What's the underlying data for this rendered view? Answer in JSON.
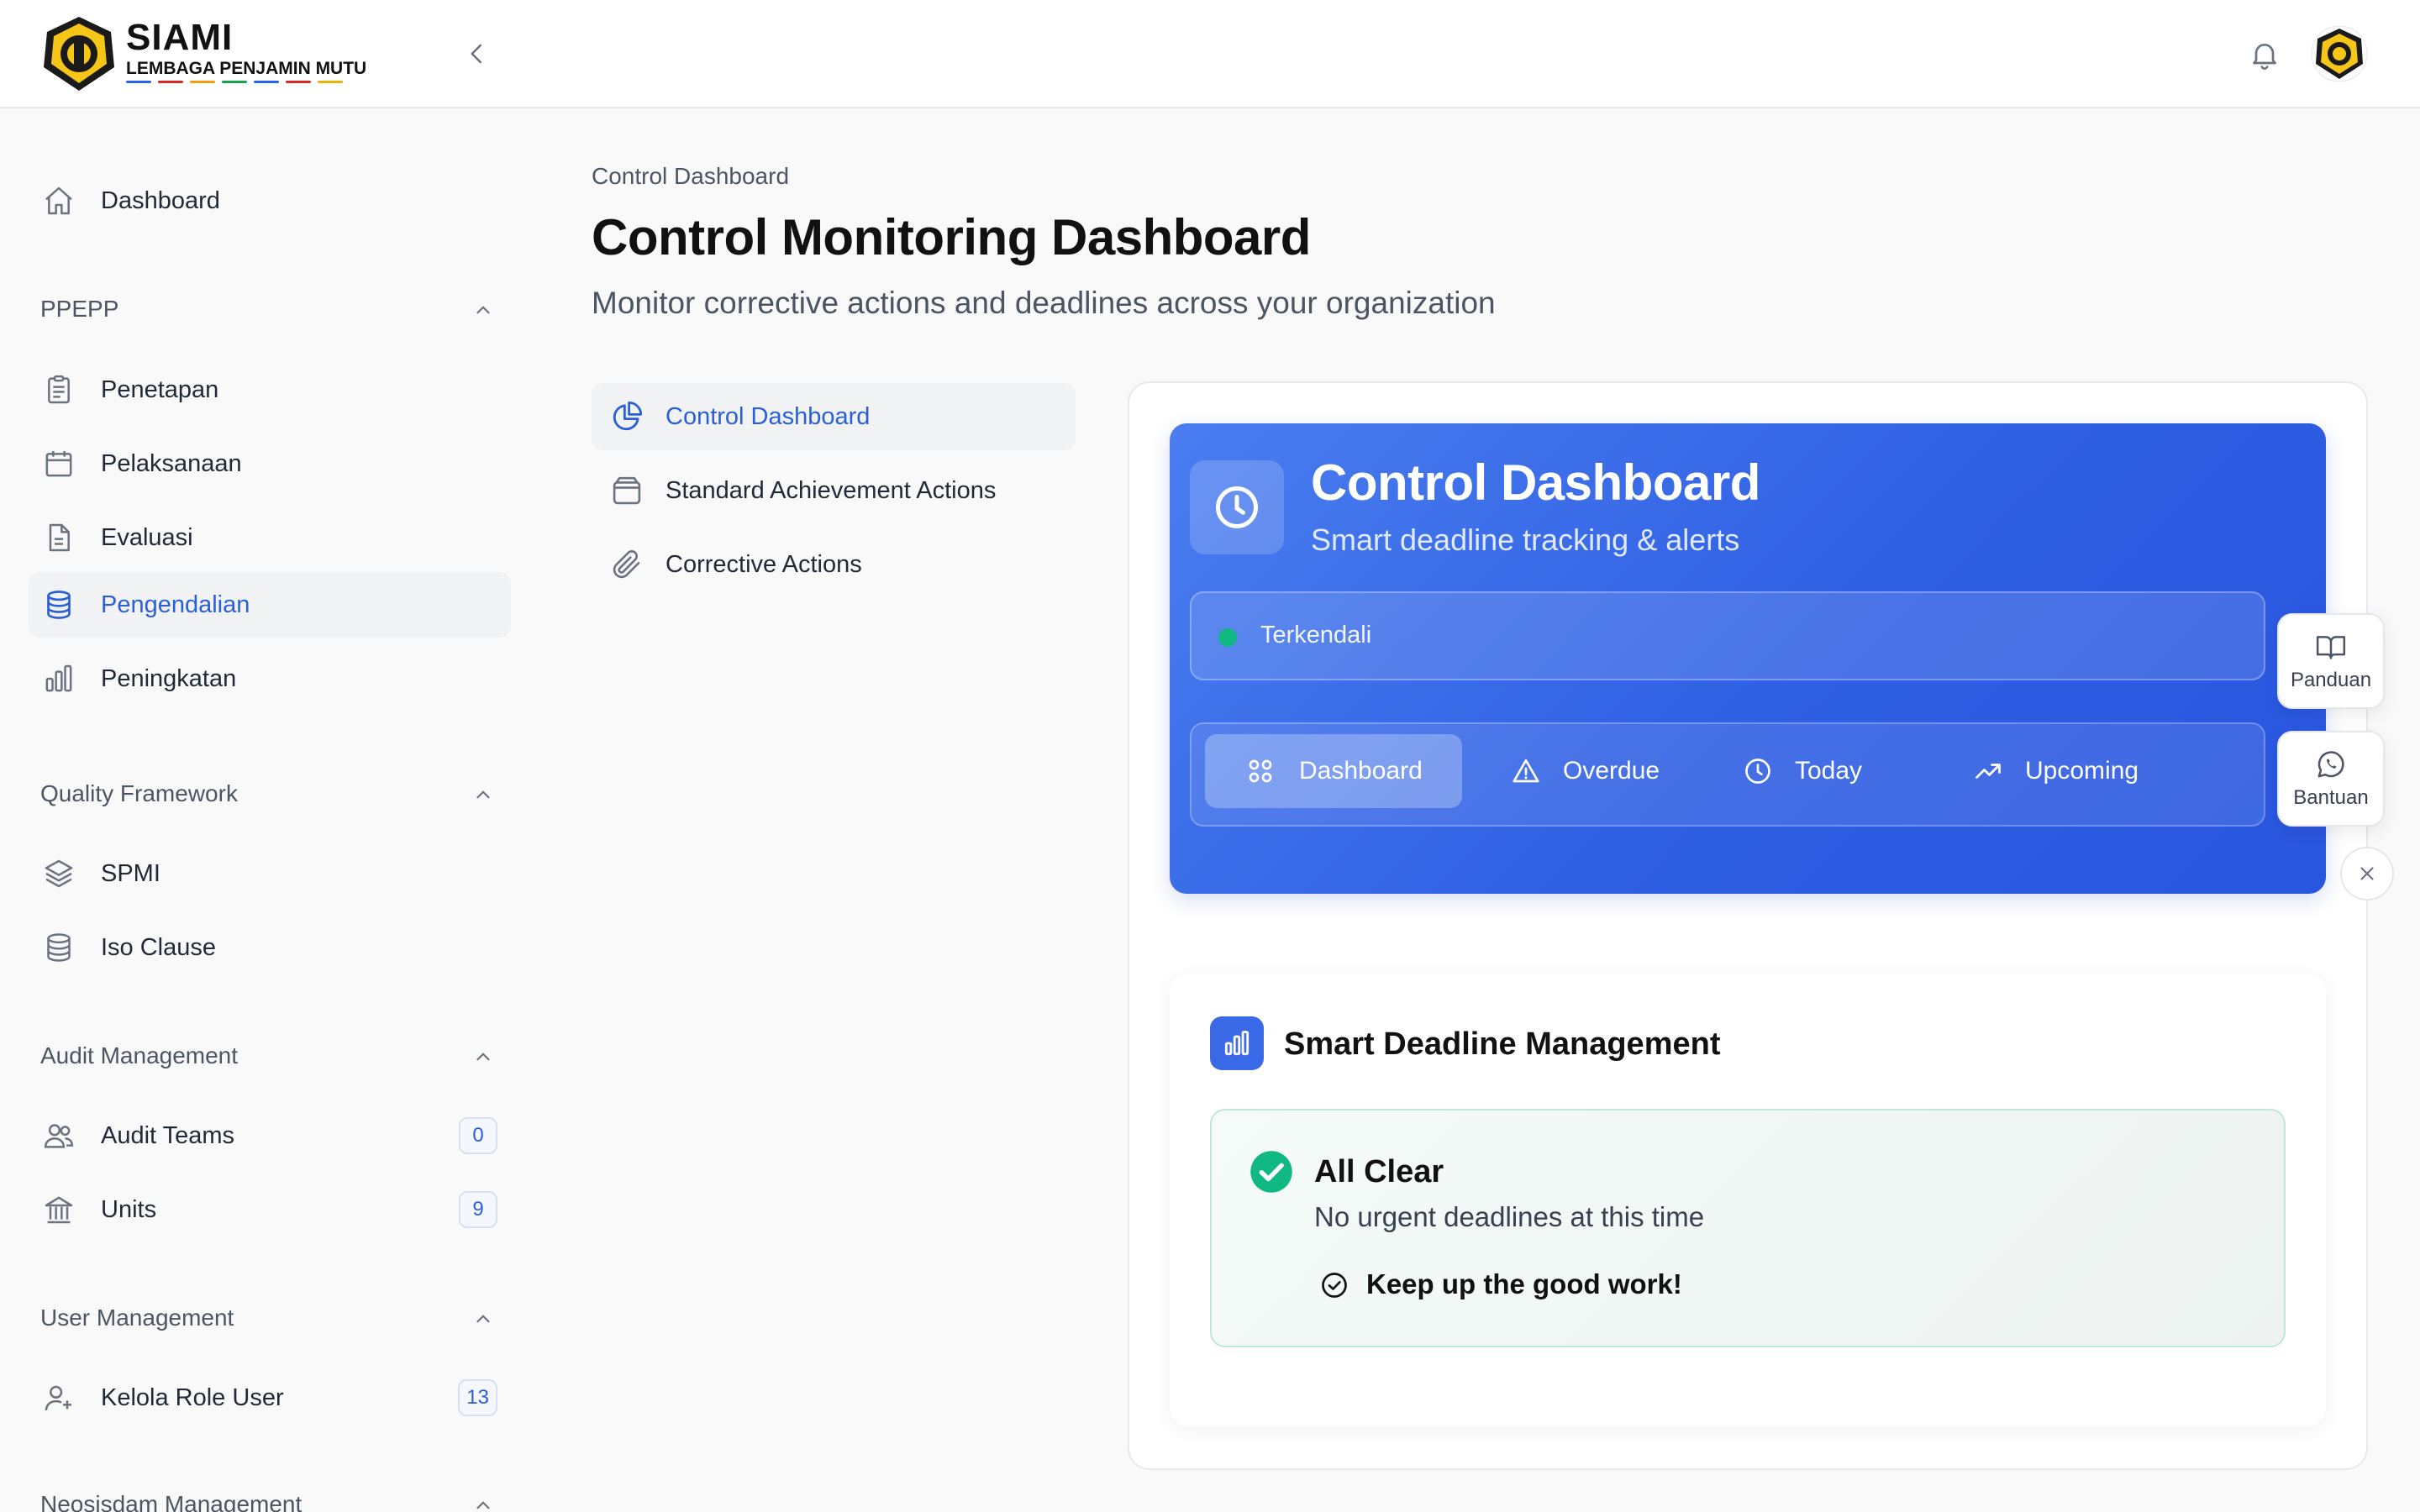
{
  "header": {
    "brand_title": "SIAMI",
    "brand_subtitle": "LEMBAGA PENJAMIN MUTU",
    "stripe_colors": [
      "#2563eb",
      "#dc2626",
      "#f59e0b",
      "#16a34a",
      "#2563eb",
      "#dc2626",
      "#eab308"
    ],
    "icons": [
      "university-seal-logo",
      "chevron-left-icon",
      "bell-icon",
      "user-avatar"
    ]
  },
  "sidebar": {
    "dashboard": {
      "label": "Dashboard",
      "icon": "home-icon"
    },
    "sections": [
      {
        "title": "PPEPP",
        "items": [
          {
            "label": "Penetapan",
            "icon": "clipboard-icon"
          },
          {
            "label": "Pelaksanaan",
            "icon": "calendar-icon"
          },
          {
            "label": "Evaluasi",
            "icon": "document-icon"
          },
          {
            "label": "Pengendalian",
            "icon": "database-icon",
            "active": true
          },
          {
            "label": "Peningkatan",
            "icon": "bar-chart-icon"
          }
        ]
      },
      {
        "title": "Quality Framework",
        "items": [
          {
            "label": "SPMI",
            "icon": "layers-icon"
          },
          {
            "label": "Iso Clause",
            "icon": "database-icon"
          }
        ]
      },
      {
        "title": "Audit Management",
        "items": [
          {
            "label": "Audit Teams",
            "icon": "users-icon",
            "count": "0"
          },
          {
            "label": "Units",
            "icon": "building-icon",
            "count": "9"
          }
        ]
      },
      {
        "title": "User Management",
        "items": [
          {
            "label": "Kelola Role User",
            "icon": "user-plus-icon",
            "count": "13"
          }
        ]
      },
      {
        "title": "Neosisdam Management",
        "items": []
      }
    ]
  },
  "main": {
    "breadcrumb": "Control Dashboard",
    "title": "Control Monitoring Dashboard",
    "subtitle": "Monitor corrective actions and deadlines across your organization",
    "subnav": [
      {
        "label": "Control Dashboard",
        "icon": "pie-chart-icon",
        "active": true
      },
      {
        "label": "Standard Achievement Actions",
        "icon": "archive-icon"
      },
      {
        "label": "Corrective Actions",
        "icon": "paperclip-icon"
      }
    ],
    "hero": {
      "title": "Control Dashboard",
      "subtitle": "Smart deadline tracking & alerts",
      "status": "Terkendali",
      "status_color": "#10b981",
      "accent_color": "#2f5fe3",
      "tabs": [
        {
          "label": "Dashboard",
          "icon": "grid-icon",
          "active": true
        },
        {
          "label": "Overdue",
          "icon": "warning-triangle-icon"
        },
        {
          "label": "Today",
          "icon": "clock-icon"
        },
        {
          "label": "Upcoming",
          "icon": "trending-up-icon"
        }
      ]
    },
    "deadline": {
      "title": "Smart Deadline Management",
      "state_title": "All Clear",
      "state_subtitle": "No urgent deadlines at this time",
      "note": "Keep up the good work!",
      "success_color": "#10b981"
    }
  },
  "floating": {
    "guide_label": "Panduan",
    "help_label": "Bantuan"
  }
}
